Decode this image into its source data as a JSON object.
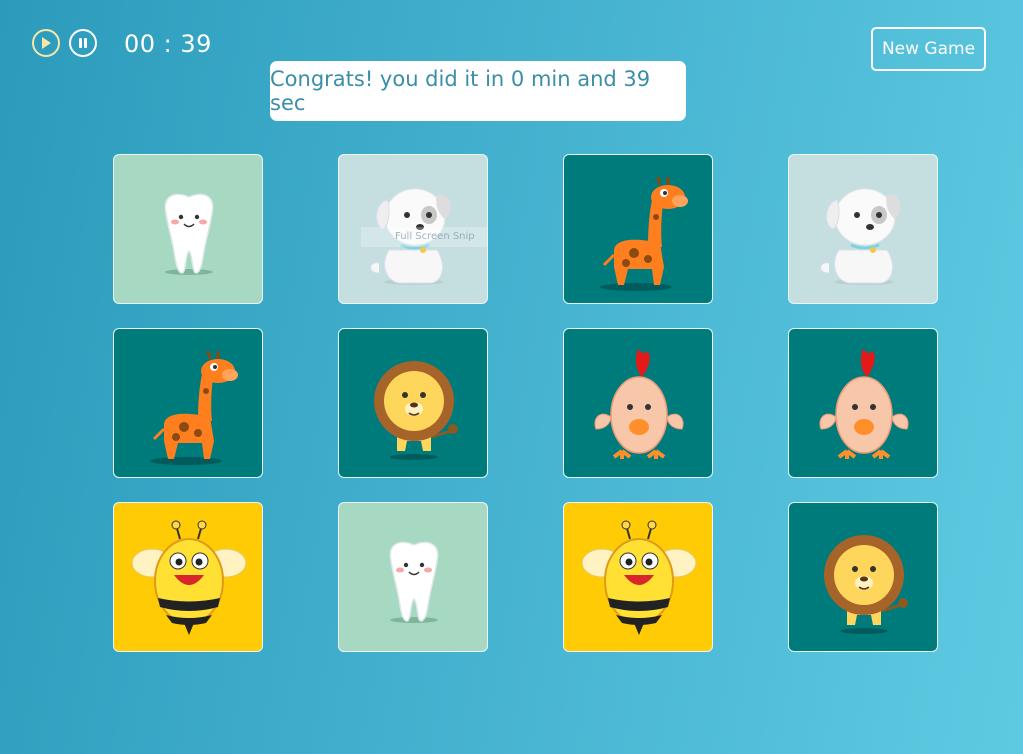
{
  "controls": {
    "play": {
      "icon": "play-icon",
      "accent": "#f6e7a8"
    },
    "pause": {
      "icon": "pause-icon"
    }
  },
  "timer": "00 : 39",
  "new_game_label": "New Game",
  "message": "Congrats! you did it in 0 min and 39 sec",
  "overlay_text": "Full Screen Snip",
  "cards": [
    {
      "image": "tooth",
      "background": "#a7d9c2"
    },
    {
      "image": "puppy",
      "background": "#c5dfe0"
    },
    {
      "image": "giraffe",
      "background": "#007b7b"
    },
    {
      "image": "puppy",
      "background": "#c5dfe0"
    },
    {
      "image": "giraffe",
      "background": "#007b7b"
    },
    {
      "image": "lion",
      "background": "#007b7b"
    },
    {
      "image": "chick",
      "background": "#007b7b"
    },
    {
      "image": "chick",
      "background": "#007b7b"
    },
    {
      "image": "bee",
      "background": "#ffcb05"
    },
    {
      "image": "tooth",
      "background": "#a7d9c2"
    },
    {
      "image": "bee",
      "background": "#ffcb05"
    },
    {
      "image": "lion",
      "background": "#007b7b"
    }
  ]
}
